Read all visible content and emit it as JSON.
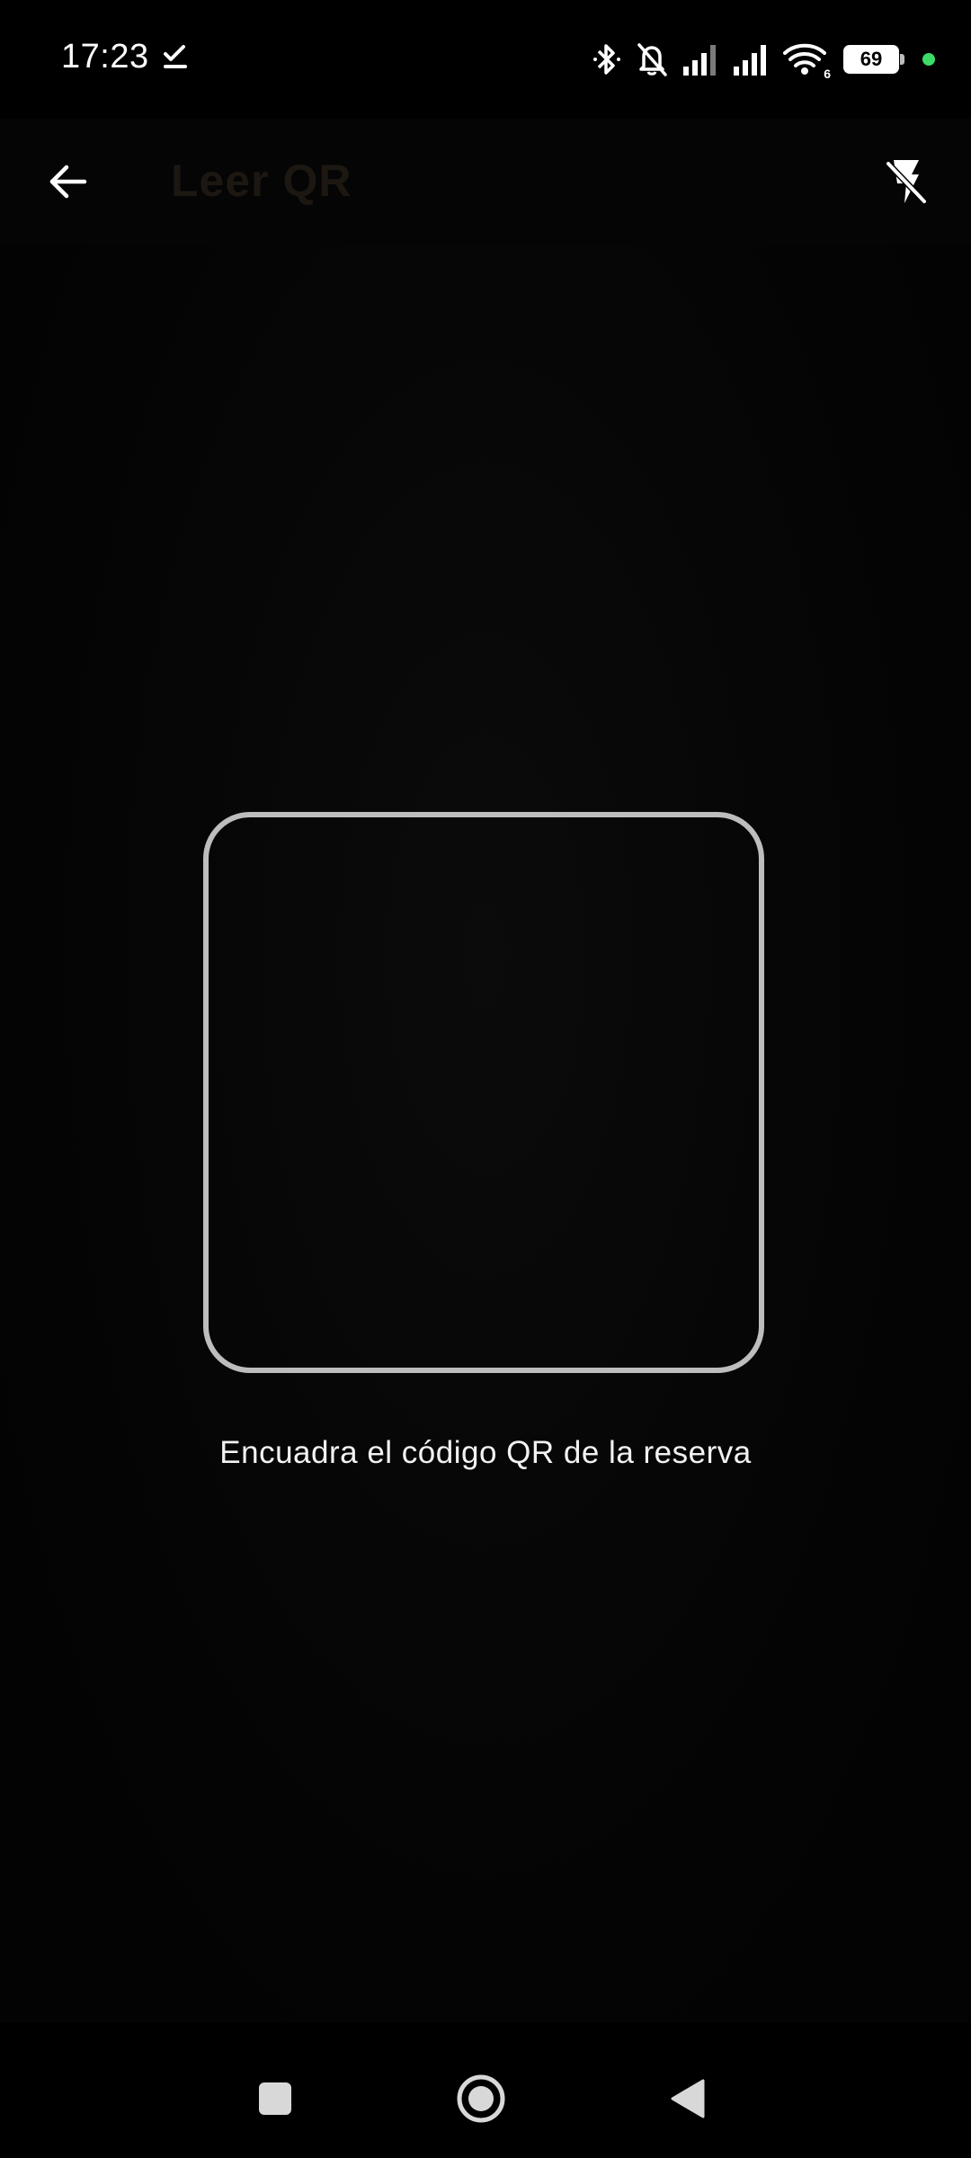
{
  "status_bar": {
    "time": "17:23",
    "battery": "69",
    "icons": [
      "task-done-icon",
      "bluetooth-icon",
      "bell-muted-icon",
      "signal-1-icon",
      "signal-2-icon",
      "wifi-icon",
      "battery-icon",
      "privacy-dot-icon"
    ],
    "wifi_badge": "6"
  },
  "app_bar": {
    "title": "Leer QR",
    "back_icon": "arrow-left-icon",
    "flash_icon": "flash-off-icon"
  },
  "scanner": {
    "hint": "Encuadra el código QR de la reserva"
  },
  "nav_bar": {
    "icons": [
      "recents-square-icon",
      "home-circle-icon",
      "back-triangle-icon"
    ]
  },
  "colors": {
    "background": "#000000",
    "frame": "#bdbdbd",
    "title": "#1d1712",
    "hint_text": "#f2f2f2",
    "privacy_dot": "#3ddc67"
  }
}
